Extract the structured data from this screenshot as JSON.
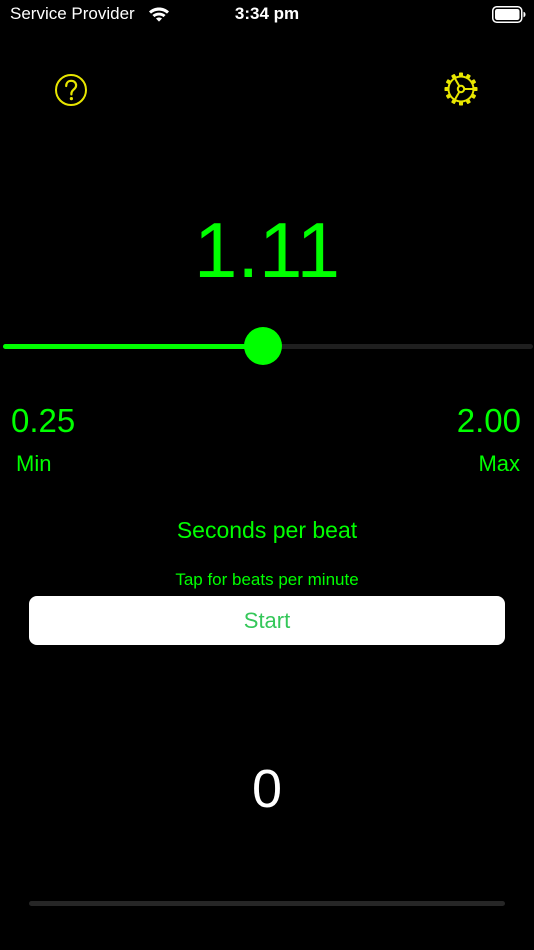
{
  "status_bar": {
    "carrier": "Service Provider",
    "time": "3:34 pm",
    "wifi_icon": "wifi-icon",
    "battery_icon": "battery-full-icon"
  },
  "toolbar": {
    "help_icon": "question-circle-icon",
    "settings_icon": "gear-icon",
    "icon_color": "#e8e600"
  },
  "metronome": {
    "value": "1.11",
    "min_value": "0.25",
    "min_label": "Min",
    "max_value": "2.00",
    "max_label": "Max",
    "slider": {
      "min": 0.25,
      "max": 2.0,
      "value": 1.11
    },
    "units_label": "Seconds per beat",
    "tap_hint": "Tap for beats per minute",
    "start_label": "Start",
    "beat_count": "0",
    "progress": 0
  },
  "colors": {
    "accent": "#00ff00",
    "background": "#000000",
    "start_text": "#34c759",
    "button_bg": "#ffffff",
    "track": "#1f1f1f"
  }
}
